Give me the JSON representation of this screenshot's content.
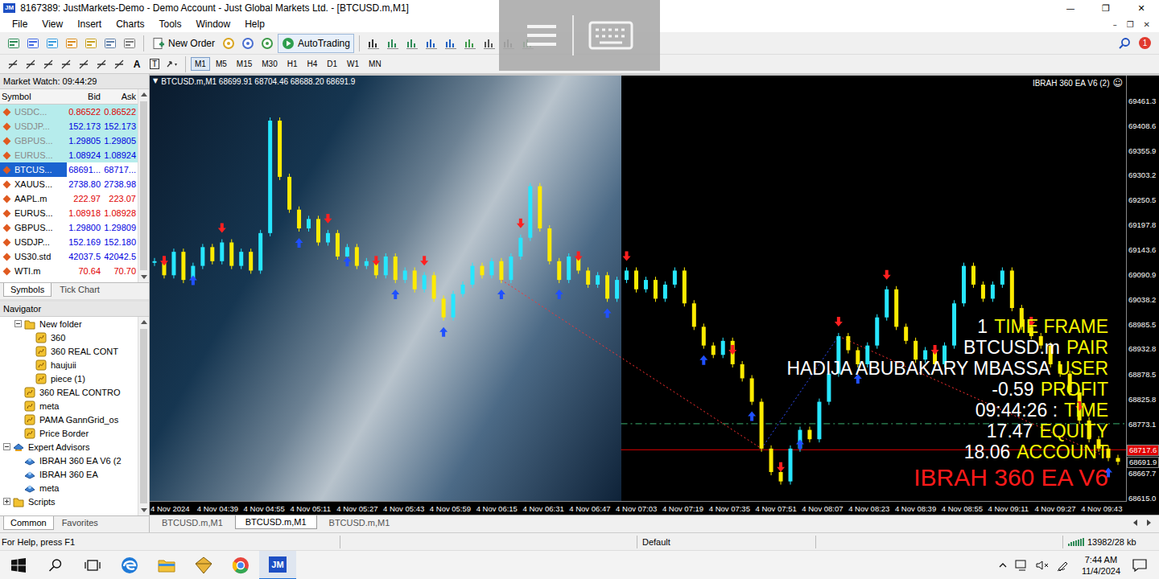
{
  "window": {
    "app_icon": "JM",
    "title": "8167389: JustMarkets-Demo - Demo Account - Just Global Markets Ltd. - [BTCUSD.m,M1]",
    "controls": [
      "—",
      "❐",
      "✕"
    ]
  },
  "menu": {
    "items": [
      "File",
      "View",
      "Insert",
      "Charts",
      "Tools",
      "Window",
      "Help"
    ],
    "mdi_controls": [
      "–",
      "❐",
      "✕"
    ]
  },
  "toolbar": {
    "new_order": "New Order",
    "autotrading": "AutoTrading",
    "notification_count": "1",
    "text_tool": "A",
    "label_tool": "T"
  },
  "periods": [
    {
      "label": "M1",
      "selected": true
    },
    {
      "label": "M5",
      "selected": false
    },
    {
      "label": "M15",
      "selected": false
    },
    {
      "label": "M30",
      "selected": false
    },
    {
      "label": "H1",
      "selected": false
    },
    {
      "label": "H4",
      "selected": false
    },
    {
      "label": "D1",
      "selected": false
    },
    {
      "label": "W1",
      "selected": false
    },
    {
      "label": "MN",
      "selected": false
    }
  ],
  "market_watch": {
    "title": "Market Watch: 09:44:29",
    "columns": [
      "Symbol",
      "Bid",
      "Ask"
    ],
    "rows": [
      {
        "symbol": "USDC...",
        "bid": "0.86522",
        "ask": "0.86522",
        "color": "#e00000",
        "faded": true,
        "selected": false
      },
      {
        "symbol": "USDJP...",
        "bid": "152.173",
        "ask": "152.173",
        "color": "#0000e0",
        "faded": true,
        "selected": false
      },
      {
        "symbol": "GBPUS...",
        "bid": "1.29805",
        "ask": "1.29805",
        "color": "#0000e0",
        "faded": true,
        "selected": false
      },
      {
        "symbol": "EURUS...",
        "bid": "1.08924",
        "ask": "1.08924",
        "color": "#0000e0",
        "faded": true,
        "selected": false
      },
      {
        "symbol": "BTCUS...",
        "bid": "68691...",
        "ask": "68717...",
        "color": "#0000e0",
        "faded": false,
        "selected": true
      },
      {
        "symbol": "XAUUS...",
        "bid": "2738.80",
        "ask": "2738.98",
        "color": "#0000e0",
        "faded": false,
        "selected": false
      },
      {
        "symbol": "AAPL.m",
        "bid": "222.97",
        "ask": "223.07",
        "color": "#e00000",
        "faded": false,
        "selected": false
      },
      {
        "symbol": "EURUS...",
        "bid": "1.08918",
        "ask": "1.08928",
        "color": "#e00000",
        "faded": false,
        "selected": false
      },
      {
        "symbol": "GBPUS...",
        "bid": "1.29800",
        "ask": "1.29809",
        "color": "#0000e0",
        "faded": false,
        "selected": false
      },
      {
        "symbol": "USDJP...",
        "bid": "152.169",
        "ask": "152.180",
        "color": "#0000e0",
        "faded": false,
        "selected": false
      },
      {
        "symbol": "US30.std",
        "bid": "42037.5",
        "ask": "42042.5",
        "color": "#0000e0",
        "faded": false,
        "selected": false
      },
      {
        "symbol": "WTI.m",
        "bid": "70.64",
        "ask": "70.70",
        "color": "#e00000",
        "faded": false,
        "selected": false
      }
    ],
    "tabs": [
      {
        "label": "Symbols",
        "selected": true
      },
      {
        "label": "Tick Chart",
        "selected": false
      }
    ]
  },
  "navigator": {
    "title": "Navigator",
    "items": [
      {
        "label": "New folder",
        "level": 1,
        "kind": "folder",
        "has_expander": true,
        "expanded": true
      },
      {
        "label": "360",
        "level": 2,
        "kind": "indicator",
        "has_expander": false,
        "expanded": false
      },
      {
        "label": "360 REAL CONT",
        "level": 2,
        "kind": "indicator",
        "has_expander": false,
        "expanded": false
      },
      {
        "label": "haujuii",
        "level": 2,
        "kind": "indicator",
        "has_expander": false,
        "expanded": false
      },
      {
        "label": "piece (1)",
        "level": 2,
        "kind": "indicator",
        "has_expander": false,
        "expanded": false
      },
      {
        "label": "360 REAL CONTRO",
        "level": 1,
        "kind": "indicator",
        "has_expander": false,
        "expanded": false
      },
      {
        "label": "meta",
        "level": 1,
        "kind": "indicator",
        "has_expander": false,
        "expanded": false
      },
      {
        "label": "PAMA GannGrid_os",
        "level": 1,
        "kind": "indicator",
        "has_expander": false,
        "expanded": false
      },
      {
        "label": "Price Border",
        "level": 1,
        "kind": "indicator",
        "has_expander": false,
        "expanded": false
      },
      {
        "label": "Expert Advisors",
        "level": 0,
        "kind": "experts",
        "has_expander": true,
        "expanded": true
      },
      {
        "label": "IBRAH 360 EA V6 (2",
        "level": 1,
        "kind": "expert",
        "has_expander": false,
        "expanded": false
      },
      {
        "label": "IBRAH 360 EA",
        "level": 1,
        "kind": "expert",
        "has_expander": false,
        "expanded": false
      },
      {
        "label": "meta",
        "level": 1,
        "kind": "expert",
        "has_expander": false,
        "expanded": false
      },
      {
        "label": "Scripts",
        "level": 0,
        "kind": "folder",
        "has_expander": true,
        "expanded": false
      }
    ],
    "tabs": [
      {
        "label": "Common",
        "selected": true
      },
      {
        "label": "Favorites",
        "selected": false
      }
    ]
  },
  "chart": {
    "collapse_glyph": "▼",
    "symbol_line": "BTCUSD.m,M1  68699.91 68704.46 68688.20 68691.9",
    "ea_name": "IBRAH 360 EA V6 (2)",
    "ea_face": "☺",
    "series": {
      "closes": [
        69120,
        69090,
        69140,
        69080,
        69110,
        69150,
        69120,
        69160,
        69110,
        69140,
        69100,
        69180,
        69420,
        69300,
        69230,
        69190,
        69210,
        69160,
        69180,
        69130,
        69150,
        69110,
        69120,
        69090,
        69130,
        69080,
        69100,
        69060,
        69090,
        69040,
        69000,
        69050,
        69070,
        69110,
        69090,
        69120,
        69080,
        69130,
        69170,
        69280,
        69190,
        69120,
        69080,
        69130,
        69100,
        69070,
        69090,
        69040,
        69080,
        69100,
        69060,
        69080,
        69040,
        69070,
        69100,
        69030,
        68980,
        68940,
        68920,
        68950,
        68900,
        68870,
        68820,
        68720,
        68670,
        68650,
        68720,
        68760,
        68740,
        68820,
        68880,
        68960,
        68930,
        68900,
        68940,
        69000,
        69060,
        68980,
        68950,
        68910,
        68930,
        68900,
        68940,
        69030,
        69110,
        69070,
        69040,
        69070,
        69100,
        69020,
        68980,
        68960,
        68940,
        68900,
        68880,
        68840,
        68780,
        68740,
        68720,
        68700,
        68691.9
      ]
    },
    "signals": [
      {
        "index": 1,
        "side": "sell"
      },
      {
        "index": 7,
        "side": "sell"
      },
      {
        "index": 18,
        "side": "sell"
      },
      {
        "index": 23,
        "side": "sell"
      },
      {
        "index": 28,
        "side": "sell"
      },
      {
        "index": 38,
        "side": "sell"
      },
      {
        "index": 44,
        "side": "sell"
      },
      {
        "index": 49,
        "side": "sell"
      },
      {
        "index": 60,
        "side": "sell"
      },
      {
        "index": 65,
        "side": "sell"
      },
      {
        "index": 71,
        "side": "sell"
      },
      {
        "index": 76,
        "side": "sell"
      },
      {
        "index": 81,
        "side": "sell"
      },
      {
        "index": 91,
        "side": "sell"
      },
      {
        "index": 96,
        "side": "sell"
      },
      {
        "index": 4,
        "side": "buy"
      },
      {
        "index": 15,
        "side": "buy"
      },
      {
        "index": 20,
        "side": "buy"
      },
      {
        "index": 25,
        "side": "buy"
      },
      {
        "index": 30,
        "side": "buy"
      },
      {
        "index": 36,
        "side": "buy"
      },
      {
        "index": 42,
        "side": "buy"
      },
      {
        "index": 47,
        "side": "buy"
      },
      {
        "index": 57,
        "side": "buy"
      },
      {
        "index": 62,
        "side": "buy"
      },
      {
        "index": 67,
        "side": "buy"
      },
      {
        "index": 73,
        "side": "buy"
      },
      {
        "index": 99,
        "side": "buy"
      }
    ],
    "trend_lines": [
      {
        "from": 36,
        "to": 63,
        "color": "#ff3030"
      },
      {
        "from": 63,
        "to": 71,
        "color": "#3050ff"
      },
      {
        "from": 71,
        "to": 99,
        "color": "#ff3030"
      }
    ],
    "level_lines": [
      {
        "price": 68773.1,
        "style": "dashed",
        "color": "#3cb371"
      },
      {
        "price": 68717.6,
        "style": "solid",
        "color": "#e00000"
      }
    ],
    "price_axis": {
      "ticks": [
        "69461.3",
        "69408.6",
        "69355.9",
        "69303.2",
        "69250.5",
        "69197.8",
        "69143.6",
        "69090.9",
        "69038.2",
        "68985.5",
        "68932.8",
        "68878.5",
        "68825.8",
        "68773.1",
        "68667.7",
        "68615.0"
      ],
      "markers": [
        {
          "text": "68717.6",
          "color": "#e00000"
        },
        {
          "text": "68691.9",
          "color": "#000000"
        }
      ]
    },
    "time_axis": [
      "4 Nov 2024",
      "4 Nov 04:39",
      "4 Nov 04:55",
      "4 Nov 05:11",
      "4 Nov 05:27",
      "4 Nov 05:43",
      "4 Nov 05:59",
      "4 Nov 06:15",
      "4 Nov 06:31",
      "4 Nov 06:47",
      "4 Nov 07:03",
      "4 Nov 07:19",
      "4 Nov 07:35",
      "4 Nov 07:51",
      "4 Nov 08:07",
      "4 Nov 08:23",
      "4 Nov 08:39",
      "4 Nov 08:55",
      "4 Nov 09:11",
      "4 Nov 09:27",
      "4 Nov 09:43"
    ],
    "info": {
      "lines": [
        {
          "value": "1",
          "label": "TIME FRAME"
        },
        {
          "value": "BTCUSD.m",
          "label": "PAIR"
        },
        {
          "value": "HADIJA ABUBAKARY MBASSA",
          "label": "USER"
        },
        {
          "value": "-0.59",
          "label": "PROFIT"
        },
        {
          "value": "09:44:26 :",
          "label": "TIME"
        },
        {
          "value": "17.47",
          "label": "EQUITY"
        },
        {
          "value": "18.06",
          "label": "ACCOUNT"
        }
      ],
      "title": "IBRAH 360 EA V6"
    }
  },
  "chart_tabs": [
    {
      "label": "BTCUSD.m,M1",
      "selected": false
    },
    {
      "label": "BTCUSD.m,M1",
      "selected": true
    },
    {
      "label": "BTCUSD.m,M1",
      "selected": false
    }
  ],
  "status_bar": {
    "help": "For Help, press F1",
    "profile": "Default",
    "traffic": "13982/28 kb"
  },
  "taskbar": {
    "pinned": [
      {
        "kind": "edge",
        "selected": false
      },
      {
        "kind": "explorer",
        "selected": false
      },
      {
        "kind": "package",
        "selected": false
      },
      {
        "kind": "chrome",
        "selected": false
      },
      {
        "kind": "terminal",
        "selected": true
      }
    ],
    "app_label": "JM",
    "time": "7:44 AM",
    "date": "11/4/2024"
  }
}
